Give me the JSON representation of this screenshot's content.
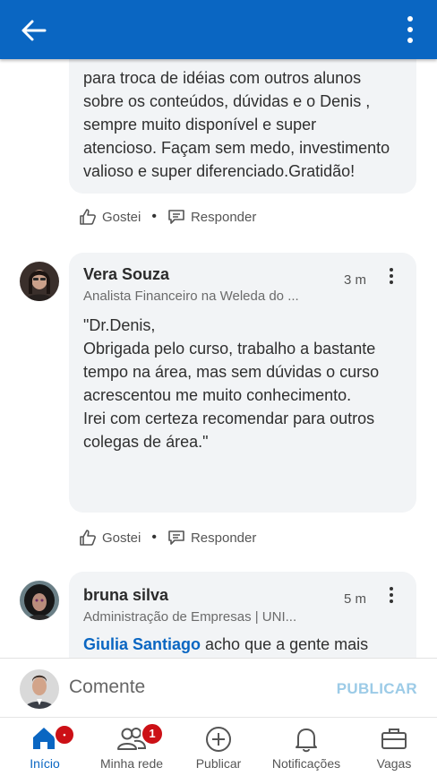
{
  "header": {
    "back_icon": "arrow-left-icon",
    "menu_icon": "more-vertical-icon",
    "bg_color": "#0a66c2"
  },
  "comments": [
    {
      "text_visible": "para  troca de idéias com outros alunos\nsobre os conteúdos, dúvidas e o Denis ,\nsempre muito disponível e super\natencioso. Façam sem medo, investimento\nvalioso e super diferenciado.Gratidão!",
      "actions": {
        "like": "Gostei",
        "reply": "Responder"
      }
    },
    {
      "name": "Vera Souza",
      "headline": "Analista Financeiro na Weleda do ...",
      "time": "3 m",
      "text": "\"Dr.Denis,\nObrigada pelo curso, trabalho a bastante\ntempo na área, mas sem dúvidas o curso\nacrescentou me muito conhecimento.\nIrei com certeza recomendar para outros\ncolegas de área.\"",
      "actions": {
        "like": "Gostei",
        "reply": "Responder"
      }
    },
    {
      "name": "bruna silva",
      "headline": "Administração de Empresas | UNI...",
      "time": "5 m",
      "mention": "Giulia Santiago",
      "text_after_mention": " acho que a gente mais"
    }
  ],
  "composer": {
    "placeholder": "Comente",
    "publish_label": "PUBLICAR"
  },
  "tabs": [
    {
      "label": "Início",
      "icon": "home-icon",
      "active": true
    },
    {
      "label": "Minha rede",
      "icon": "people-icon",
      "badge": "1"
    },
    {
      "label": "Publicar",
      "icon": "plus-circle-icon"
    },
    {
      "label": "Notificações",
      "icon": "bell-icon"
    },
    {
      "label": "Vagas",
      "icon": "briefcase-icon"
    }
  ]
}
